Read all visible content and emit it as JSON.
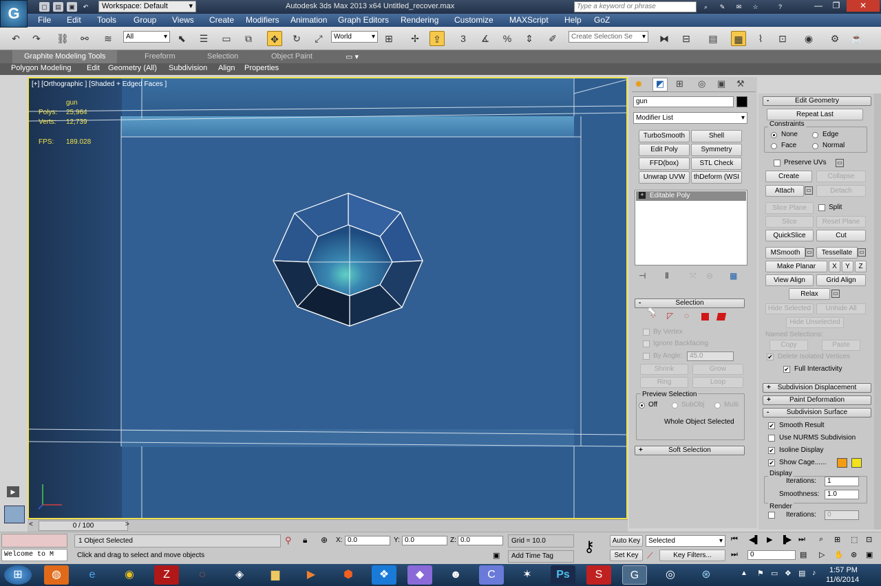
{
  "title_bar": {
    "workspace": "Workspace: Default",
    "title": "Autodesk 3ds Max  2013 x64      Untitled_recover.max",
    "search_placeholder": "Type a keyword or phrase"
  },
  "menu": [
    "File",
    "Edit",
    "Tools",
    "Group",
    "Views",
    "Create",
    "Modifiers",
    "Animation",
    "Graph Editors",
    "Rendering",
    "Customize",
    "MAXScript",
    "Help",
    "GoZ"
  ],
  "toolbar": {
    "filter": "All",
    "coord_system": "World",
    "selection_set": "Create Selection Se"
  },
  "ribbon": {
    "tabs": [
      "Graphite Modeling Tools",
      "Freeform",
      "Selection",
      "Object Paint"
    ],
    "subtabs": [
      "Polygon Modeling",
      "Edit",
      "Geometry (All)",
      "Subdivision",
      "Align",
      "Properties"
    ]
  },
  "viewport": {
    "label": "[+] [Orthographic ] [Shaded + Edged Faces ]",
    "stats": {
      "object": "gun",
      "polys_label": "Polys:",
      "polys": "25,964",
      "verts_label": "Verts:",
      "verts": "12,739",
      "fps_label": "FPS:",
      "fps": "189.028"
    }
  },
  "command_panel": {
    "object_name": "gun",
    "modifier_list": "Modifier List",
    "modifier_buttons": [
      "TurboSmooth",
      "Shell",
      "Edit Poly",
      "Symmetry",
      "FFD(box)",
      "STL Check",
      "Unwrap UVW",
      "thDeform (WSI"
    ],
    "stack_item": "Editable Poly",
    "selection": {
      "title": "Selection",
      "by_vertex": "By Vertex",
      "ignore_backfacing": "Ignore Backfacing",
      "by_angle": "By Angle:",
      "angle": "45.0",
      "shrink": "Shrink",
      "grow": "Grow",
      "ring": "Ring",
      "loop": "Loop",
      "preview_title": "Preview Selection",
      "preview_off": "Off",
      "preview_subobj": "SubObj",
      "preview_multi": "Multi",
      "status": "Whole Object Selected"
    },
    "soft_selection": "Soft Selection"
  },
  "edit_geometry": {
    "title": "Edit Geometry",
    "repeat_last": "Repeat Last",
    "constraints": "Constraints",
    "c_none": "None",
    "c_edge": "Edge",
    "c_face": "Face",
    "c_normal": "Normal",
    "preserve_uvs": "Preserve UVs",
    "create": "Create",
    "collapse": "Collapse",
    "attach": "Attach",
    "detach": "Detach",
    "slice_plane": "Slice Plane",
    "split": "Split",
    "slice": "Slice",
    "reset_plane": "Reset Plane",
    "quickslice": "QuickSlice",
    "cut": "Cut",
    "msmooth": "MSmooth",
    "tessellate": "Tessellate",
    "make_planar": "Make Planar",
    "x": "X",
    "y": "Y",
    "z": "Z",
    "view_align": "View Align",
    "grid_align": "Grid Align",
    "relax": "Relax",
    "hide_selected": "Hide Selected",
    "unhide_all": "Unhide All",
    "hide_unselected": "Hide Unselected",
    "named_selections": "Named Selections:",
    "copy": "Copy",
    "paste": "Paste",
    "delete_isolated": "Delete Isolated Vertices",
    "full_interactivity": "Full Interactivity"
  },
  "subdivision": {
    "displacement": "Subdivision Displacement",
    "paint_deformation": "Paint Deformation",
    "surface": "Subdivision Surface",
    "smooth_result": "Smooth Result",
    "use_nurms": "Use NURMS Subdivision",
    "isoline": "Isoline Display",
    "show_cage": "Show Cage......",
    "cage_color_1": "#f39c12",
    "cage_color_2": "#f1e21a",
    "display": "Display",
    "iterations_label": "Iterations:",
    "iterations": "1",
    "smoothness_label": "Smoothness:",
    "smoothness": "1.0",
    "render": "Render",
    "render_iterations": "0"
  },
  "timeline": {
    "frame": "0 / 100"
  },
  "status": {
    "maxscript": "Welcome to M",
    "selected": "1 Object Selected",
    "prompt": "Click and drag to select and move objects",
    "x_label": "X:",
    "x": "0.0",
    "y_label": "Y:",
    "y": "0.0",
    "z_label": "Z:",
    "z": "0.0",
    "grid": "Grid = 10.0",
    "add_time_tag": "Add Time Tag",
    "auto_key": "Auto Key",
    "set_key": "Set Key",
    "key_mode": "Selected",
    "key_filters": "Key Filters...",
    "current_frame": "0"
  },
  "taskbar": {
    "time": "1:57 PM",
    "date": "11/6/2014"
  }
}
